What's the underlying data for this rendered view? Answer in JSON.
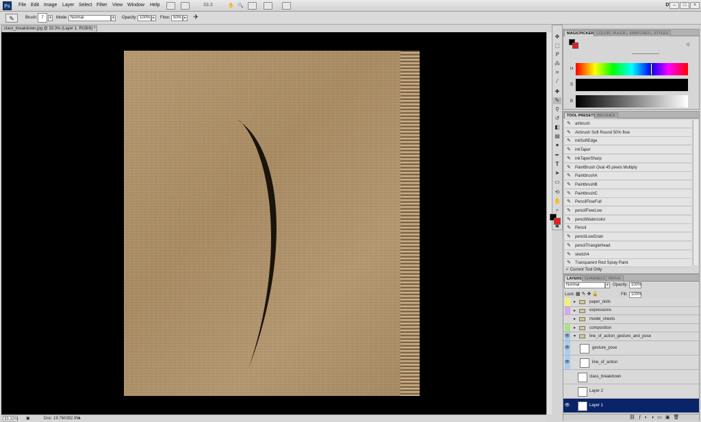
{
  "menubar": {
    "logo": "Ps",
    "items": [
      "File",
      "Edit",
      "Image",
      "Layer",
      "Select",
      "Filter",
      "View",
      "Window",
      "Help"
    ],
    "zoom": "33.3",
    "workspace": "DW",
    "window_buttons": [
      "–",
      "□",
      "×"
    ]
  },
  "options": {
    "brush_label": "Brush:",
    "brush_size": "7",
    "mode_label": "Mode:",
    "mode_value": "Normal",
    "opacity_label": "Opacity:",
    "opacity_value": "100%",
    "flow_label": "Flow:",
    "flow_value": "50%"
  },
  "document": {
    "tab_title": "class_breakdown.jpg @ 33.3% (Layer 1, RGB/8) *",
    "close": "×"
  },
  "status": {
    "zoom": "33.33%",
    "doc": "Doc: 19.7M/392.9M"
  },
  "magic_picker": {
    "tabs": [
      "MAGICPICKER",
      "COLOR",
      "RULER",
      "SWATCHES",
      "STYLES"
    ],
    "h_label": "H",
    "s_label": "S",
    "b_label": "B"
  },
  "tool_presets": {
    "tabs": [
      "TOOL PRESETS",
      "BRUSHES"
    ],
    "items": [
      "airbrush",
      "Airbrush Soft Round 50% flow",
      "inkSoftEdge",
      "inkTaper",
      "inkTaperSharp",
      "PaintBrush Oval 45 pixels Multiply",
      "PaintbrushA",
      "PaintbrushB",
      "PaintbrushC",
      "PencilFlowFull",
      "pencilFlowLow",
      "pencilWatercolor",
      "Pencil",
      "pencilLowGrain",
      "pencilTriangleHead",
      "sketch4",
      "Transparent Red Spray Paint"
    ],
    "current_tool_only": "Current Tool Only"
  },
  "layers": {
    "tabs": [
      "LAYERS",
      "CHANNELS",
      "PATHS"
    ],
    "blend_mode": "Normal",
    "opacity_label": "Opacity:",
    "opacity_value": "100%",
    "lock_label": "Lock:",
    "fill_label": "Fill:",
    "fill_value": "100%",
    "rows": [
      {
        "name": "paper_dolls",
        "type": "group",
        "tag": "#f3f07a"
      },
      {
        "name": "expressions",
        "type": "group",
        "tag": "#d6a6f0"
      },
      {
        "name": "model_sheets",
        "type": "group",
        "tag": "#d9d9d9"
      },
      {
        "name": "composition",
        "type": "group",
        "tag": "#a9e38a"
      },
      {
        "name": "line_of_action_gesture_and_pose",
        "type": "group",
        "tag": "#a8cdf0"
      },
      {
        "name": "gesture_pose",
        "type": "layer",
        "tag": "#a8cdf0"
      },
      {
        "name": "line_of_action",
        "type": "layer",
        "tag": "#a8cdf0"
      },
      {
        "name": "class_breakdown",
        "type": "layer",
        "tag": ""
      },
      {
        "name": "Layer 2",
        "type": "layer",
        "tag": ""
      },
      {
        "name": "Layer 1",
        "type": "layer",
        "tag": "",
        "selected": true
      }
    ]
  },
  "colors": {
    "foreground": "#000000",
    "background": "#ee1c1c",
    "selected_layer": "#0a246a"
  }
}
